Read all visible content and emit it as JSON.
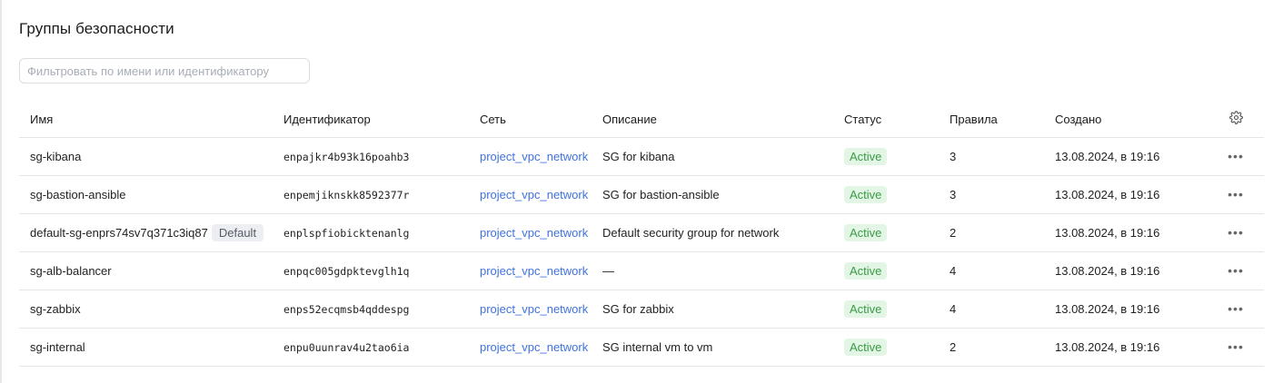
{
  "page": {
    "title": "Группы безопасности"
  },
  "filter": {
    "placeholder": "Фильтровать по имени или идентификатору",
    "value": ""
  },
  "table": {
    "columns": {
      "name": "Имя",
      "id": "Идентификатор",
      "network": "Сеть",
      "description": "Описание",
      "status": "Статус",
      "rules": "Правила",
      "created": "Создано"
    },
    "settings_icon": "gear-icon",
    "actions_icon": "more-horizontal-icon",
    "rows": [
      {
        "name": "sg-kibana",
        "badge": "",
        "id": "enpajkr4b93k16poahb3",
        "network": "project_vpc_network",
        "description": "SG for kibana",
        "status": "Active",
        "rules": "3",
        "created": "13.08.2024, в 19:16"
      },
      {
        "name": "sg-bastion-ansible",
        "badge": "",
        "id": "enpemjiknskk8592377r",
        "network": "project_vpc_network",
        "description": "SG for bastion-ansible",
        "status": "Active",
        "rules": "3",
        "created": "13.08.2024, в 19:16"
      },
      {
        "name": "default-sg-enprs74sv7q371c3iq87",
        "badge": "Default",
        "id": "enplspfiobicktenanlg",
        "network": "project_vpc_network",
        "description": "Default security group for network",
        "status": "Active",
        "rules": "2",
        "created": "13.08.2024, в 19:16"
      },
      {
        "name": "sg-alb-balancer",
        "badge": "",
        "id": "enpqc005gdpktevglh1q",
        "network": "project_vpc_network",
        "description": "—",
        "status": "Active",
        "rules": "4",
        "created": "13.08.2024, в 19:16"
      },
      {
        "name": "sg-zabbix",
        "badge": "",
        "id": "enps52ecqmsb4qddespg",
        "network": "project_vpc_network",
        "description": "SG for zabbix",
        "status": "Active",
        "rules": "4",
        "created": "13.08.2024, в 19:16"
      },
      {
        "name": "sg-internal",
        "badge": "",
        "id": "enpu0uunrav4u2tao6ia",
        "network": "project_vpc_network",
        "description": "SG internal vm to vm",
        "status": "Active",
        "rules": "2",
        "created": "13.08.2024, в 19:16"
      }
    ]
  },
  "colors": {
    "link": "#3f72e0",
    "status_active_bg": "#e3f6e5",
    "status_active_text": "#3a9b45"
  }
}
